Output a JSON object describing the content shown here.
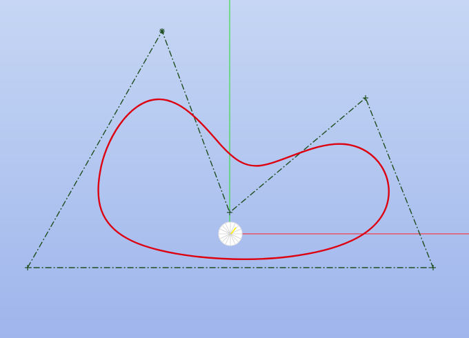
{
  "viewport": {
    "background_top": "#c6d6f4",
    "background_bottom": "#9fb5ec"
  },
  "axes": {
    "x_axis_color": "#ff0000",
    "y_axis_color": "#00e000"
  },
  "control_polygon": {
    "color": "#1a4a1a",
    "style": "dash-dot",
    "vertex_marker": "plus-cross-icon"
  },
  "curve": {
    "color": "#dd0010",
    "type": "closed-spline"
  },
  "origin_marker": {
    "icon": "origin-sphere-icon",
    "fill": "#ffffff",
    "highlight": "#ffee00"
  }
}
